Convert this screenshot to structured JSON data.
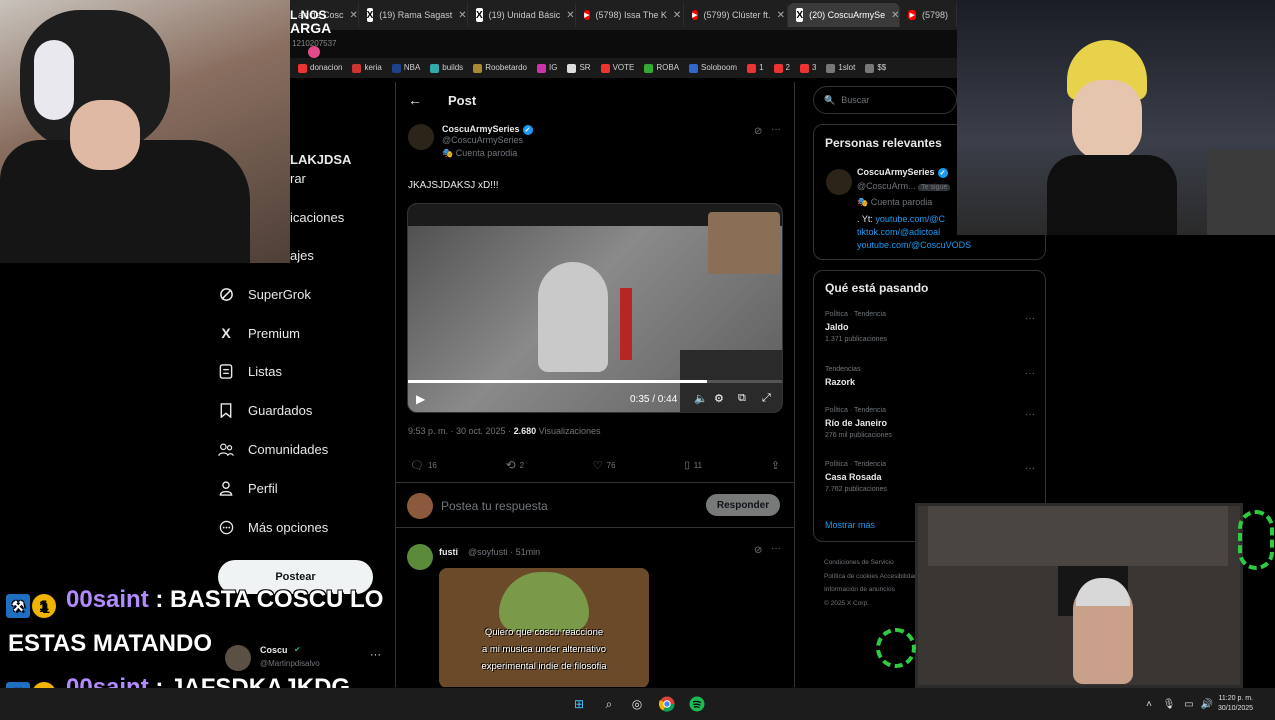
{
  "browser": {
    "tabs": [
      {
        "label": "an de Cosc",
        "icon": "x"
      },
      {
        "label": "(19) Rama Sagast",
        "icon": "x"
      },
      {
        "label": "(19) Unidad Básic",
        "icon": "x"
      },
      {
        "label": "(5798) Issa The K",
        "icon": "youtube"
      },
      {
        "label": "(5799) Clúster ft.",
        "icon": "youtube"
      },
      {
        "label": "(20) CoscuArmySe",
        "icon": "x",
        "active": true
      },
      {
        "label": "(5798)",
        "icon": "youtube"
      }
    ],
    "bookmarks": [
      "donacion",
      "keria",
      "NBA",
      "builds",
      "Roobetardo",
      "IG",
      "SR",
      "VOTE",
      "ROBA",
      "Soloboom",
      "1",
      "2",
      "3",
      "1slot",
      "$$"
    ],
    "stream_text_1": "ARGA",
    "stream_text_2": "1210207537",
    "stream_text_3": "L NOS"
  },
  "left_nav": {
    "partial_1": "LAKJDSA",
    "partial_2": "rar",
    "partial_3": "icaciones",
    "partial_4": "ajes",
    "items": [
      {
        "label": "SuperGrok",
        "icon": "supergrok-icon"
      },
      {
        "label": "Premium",
        "icon": "x-logo-icon"
      },
      {
        "label": "Listas",
        "icon": "list-icon"
      },
      {
        "label": "Guardados",
        "icon": "bookmark-icon"
      },
      {
        "label": "Comunidades",
        "icon": "communities-icon"
      },
      {
        "label": "Perfil",
        "icon": "profile-icon"
      },
      {
        "label": "Más opciones",
        "icon": "more-options-icon"
      }
    ],
    "post_button": "Postear",
    "account_name": "Coscu",
    "account_handle": "@Martinpdisalvo"
  },
  "post": {
    "header_title": "Post",
    "author_name": "CoscuArmySeries",
    "author_handle": "@CoscuArmySeries",
    "author_label": "Cuenta parodia",
    "text": "JKAJSJDAKSJ xD!!!",
    "video_time": "0:35 / 0:44",
    "timestamp": "9:53 p. m. · 30 oct. 2025 ·",
    "views_count": "2.680",
    "views_label": "Visualizaciones",
    "replies": "16",
    "reposts": "2",
    "likes": "76",
    "bookmarks": "11",
    "reply_placeholder": "Postea tu respuesta",
    "reply_button": "Responder"
  },
  "reply": {
    "author_name": "fusti",
    "author_handle": "@soyfusti · 51min",
    "meme_text_1": "Quiero que coscu reaccione",
    "meme_text_2": "a mi musica under alternativo",
    "meme_text_3": "experimental indie de filosofia"
  },
  "right": {
    "search_placeholder": "Buscar",
    "relevant_title": "Personas relevantes",
    "relevant_name": "CoscuArmySeries",
    "relevant_handle": "@CoscuArm...",
    "relevant_follows": "Te sigue",
    "relevant_label": "Cuenta parodia",
    "bio_1_prefix": ". Yt: ",
    "bio_1_link": "youtube.com/@C",
    "bio_2": "tiktok.com/@adictoal",
    "bio_3": "youtube.com/@CoscuVODS",
    "trends_title": "Qué está pasando",
    "trends": [
      {
        "meta": "Política · Tendencia",
        "name": "Jaldo",
        "count": "1.371 publicaciones"
      },
      {
        "meta": "Tendencias",
        "name": "Razork",
        "count": ""
      },
      {
        "meta": "Política · Tendencia",
        "name": "Río de Janeiro",
        "count": "276 mil publicaciones"
      },
      {
        "meta": "Política · Tendencia",
        "name": "Casa Rosada",
        "count": "7.762 publicaciones"
      }
    ],
    "show_more": "Mostrar más",
    "footer_1": "Condiciones de Servicio",
    "footer_2": "Política de cookies",
    "footer_3": "Accesibilidad",
    "footer_4": "Información de anuncios",
    "footer_5": "© 2025 X Corp."
  },
  "chat": [
    {
      "user": "00saint",
      "text": "BASTA COSCU LO"
    },
    {
      "continuation": "ESTAS MATANDO"
    },
    {
      "user": "00saint",
      "text": "JAFSDKAJKDG"
    }
  ],
  "taskbar": {
    "time": "11:20 p. m.",
    "date": "30/10/2025"
  }
}
